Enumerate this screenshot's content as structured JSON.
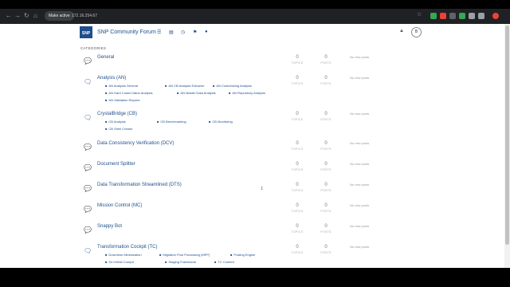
{
  "browser": {
    "badge": "Make active",
    "url": "172.16.254.67",
    "ext_colors": [
      "#34a853",
      "#ea4335",
      "#5f6368",
      "#34a853",
      "#9aa0a6",
      "#9aa0a6"
    ],
    "profile_color": "#ea4335"
  },
  "site": {
    "logo": "SNP",
    "title": "SNP Community Forum",
    "avatar": "B"
  },
  "categories_header": "CATEGORIES",
  "labels": {
    "topics": "TOPICS",
    "posts": "POSTS",
    "no_posts": "No new posts"
  },
  "categories": [
    {
      "name": "General",
      "topics": "0",
      "posts": "0",
      "subs": []
    },
    {
      "name": "Analysis (AN)",
      "topics": "0",
      "posts": "0",
      "subs": [
        "AN Analysis General",
        "AN CB Analysis Extractor",
        "AN Customizing Analysis",
        "AN Hard Coded Value Analysis",
        "AN Master Data Analysis",
        "AN Repository Analysis",
        "AN Validation Reports"
      ]
    },
    {
      "name": "CrystalBridge (CB)",
      "topics": "0",
      "posts": "0",
      "subs": [
        "CB Analysis",
        "CB Benchmarking",
        "CB Monitoring",
        "CB Shell Creator"
      ]
    },
    {
      "name": "Data Consistency Verification (DCV)",
      "topics": "0",
      "posts": "0",
      "subs": []
    },
    {
      "name": "Document Splitter",
      "topics": "0",
      "posts": "0",
      "subs": []
    },
    {
      "name": "Data Transformation Streamlined (DTS)",
      "topics": "0",
      "posts": "0",
      "subs": []
    },
    {
      "name": "Mission Control (MC)",
      "topics": "0",
      "posts": "0",
      "subs": []
    },
    {
      "name": "Snappy Bot",
      "topics": "0",
      "posts": "0",
      "subs": []
    },
    {
      "name": "Transformation Cockpit (TC)",
      "topics": "0",
      "posts": "0",
      "subs": [
        "Downtime Minimization",
        "Migration Post Processing (MPP)",
        "Posting Engine",
        "S4 HANA Cockpit",
        "Staging Framework",
        "TC Content"
      ]
    }
  ]
}
